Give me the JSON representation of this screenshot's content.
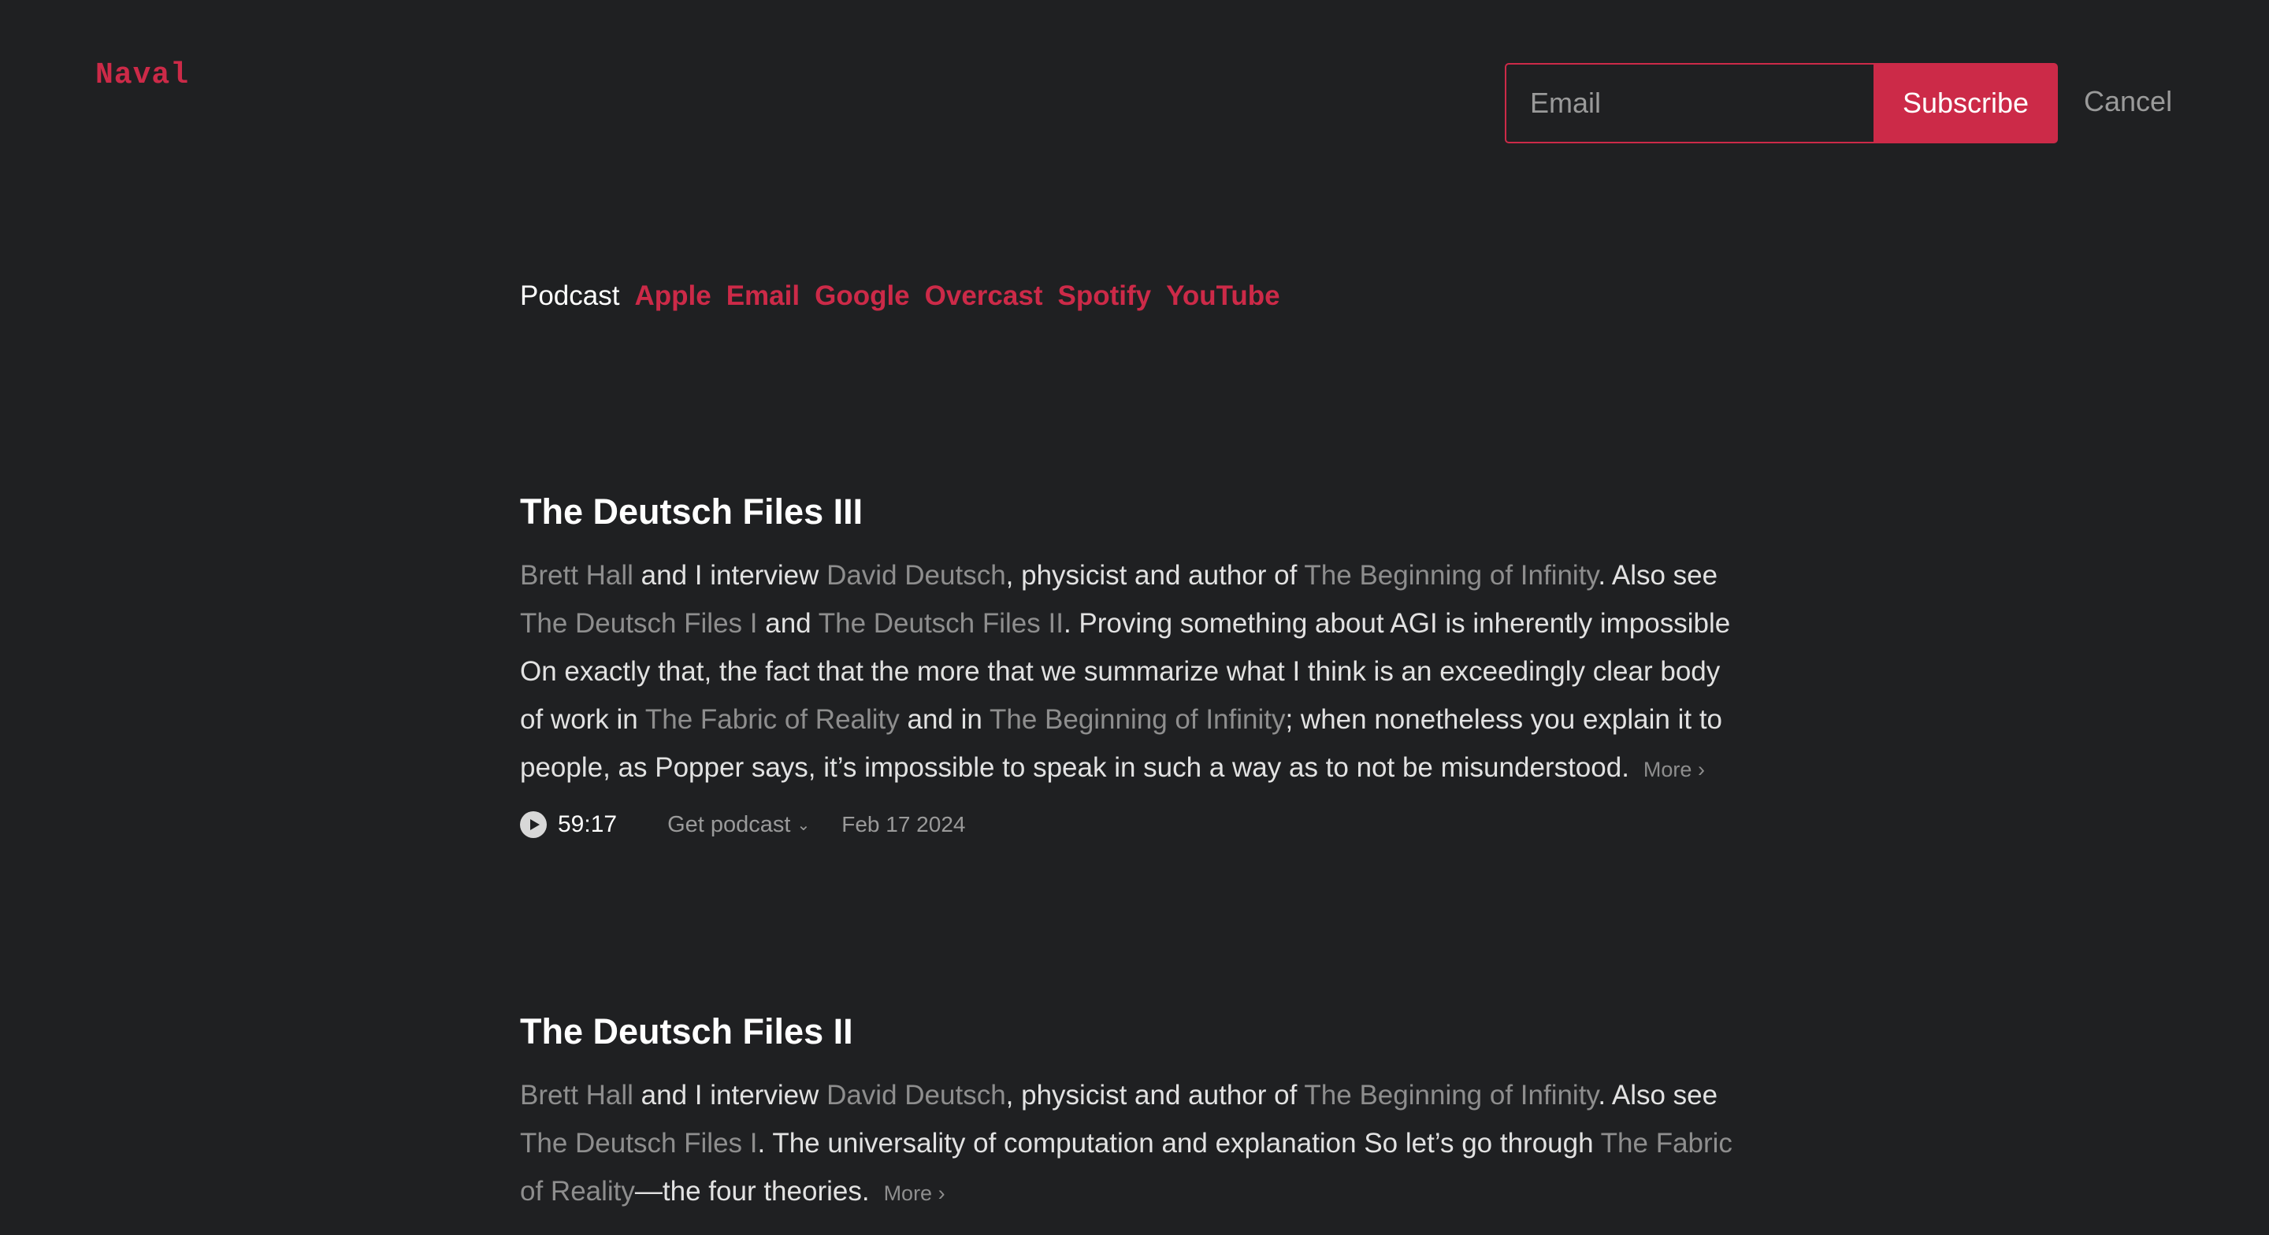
{
  "brand": "Naval",
  "subscribe": {
    "email_placeholder": "Email",
    "subscribe_label": "Subscribe",
    "cancel_label": "Cancel"
  },
  "podcast_nav": {
    "label": "Podcast",
    "links": [
      "Apple",
      "Email",
      "Google",
      "Overcast",
      "Spotify",
      "YouTube"
    ]
  },
  "episodes": [
    {
      "title": "The Deutsch Files III",
      "desc": [
        {
          "t": "Brett Hall",
          "link": true
        },
        {
          "t": " and I interview ",
          "link": false
        },
        {
          "t": "David Deutsch",
          "link": true
        },
        {
          "t": ", physicist and author of ",
          "link": false
        },
        {
          "t": "The Beginning of Infinity",
          "link": true
        },
        {
          "t": ". Also see ",
          "link": false
        },
        {
          "t": "The Deutsch Files I",
          "link": true
        },
        {
          "t": " and ",
          "link": false
        },
        {
          "t": "The Deutsch Files II",
          "link": true
        },
        {
          "t": ". Proving something about AGI is inherently impossible On exactly that, the fact that the more that we summarize what I think is an exceedingly clear body of work in ",
          "link": false
        },
        {
          "t": "The Fabric of Reality",
          "link": true
        },
        {
          "t": " and in ",
          "link": false
        },
        {
          "t": "The Beginning of Infinity",
          "link": true
        },
        {
          "t": "; when nonetheless you explain it to people, as Popper says, it’s impossible to speak in such a way as to not be misunderstood.",
          "link": false
        }
      ],
      "more_label": "More ›",
      "duration": "59:17",
      "get_podcast_label": "Get podcast",
      "date": "Feb 17 2024"
    },
    {
      "title": "The Deutsch Files II",
      "desc": [
        {
          "t": "Brett Hall",
          "link": true
        },
        {
          "t": " and I interview ",
          "link": false
        },
        {
          "t": "David Deutsch",
          "link": true
        },
        {
          "t": ", physicist and author of ",
          "link": false
        },
        {
          "t": "The Beginning of Infinity",
          "link": true
        },
        {
          "t": ". Also see ",
          "link": false
        },
        {
          "t": "The Deutsch Files I",
          "link": true
        },
        {
          "t": ". The universality of computation and explanation So let’s go through ",
          "link": false
        },
        {
          "t": "The Fabric of Reality",
          "link": true
        },
        {
          "t": "—the four theories.",
          "link": false
        }
      ],
      "more_label": "More ›"
    }
  ],
  "colors": {
    "background": "#1f2022",
    "accent": "#cc2a48",
    "muted_link": "#8e8e8e"
  },
  "icons": {
    "play": "play-circle-icon",
    "chevron": "chevron-down-icon"
  }
}
